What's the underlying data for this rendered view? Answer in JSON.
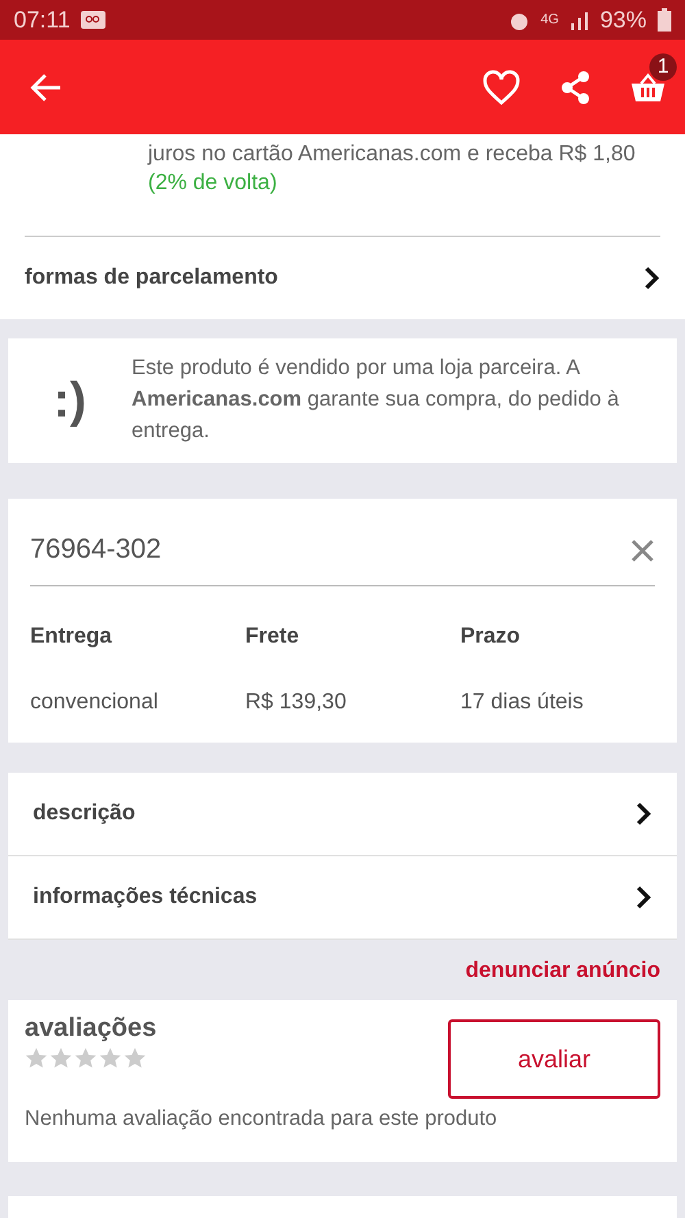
{
  "status_bar": {
    "time": "07:11",
    "network": "4G",
    "battery": "93%"
  },
  "header": {
    "cart_count": "1"
  },
  "cashback": {
    "line1": "juros no cartão Americanas.com  e receba R$",
    "amount": "1,80",
    "bonus": "(2% de volta)"
  },
  "installments": {
    "label": "formas de parcelamento"
  },
  "seller_notice": {
    "face": ":)",
    "text": "Este produto é vendido por uma loja parceira. A **Americanas.com** garante sua compra, do pedido à entrega."
  },
  "shipping": {
    "cep": "76964-302",
    "columns": [
      "Entrega",
      "Frete",
      "Prazo"
    ],
    "rows": [
      [
        "convencional",
        "R$ 139,30",
        "17 dias úteis"
      ]
    ]
  },
  "links": [
    {
      "label": "descrição"
    },
    {
      "label": "informações técnicas"
    }
  ],
  "report": {
    "label": "denunciar anúncio"
  },
  "reviews": {
    "title": "avaliações",
    "stars": 0,
    "button": "avaliar",
    "empty": "Nenhuma avaliação encontrada para este produto"
  }
}
